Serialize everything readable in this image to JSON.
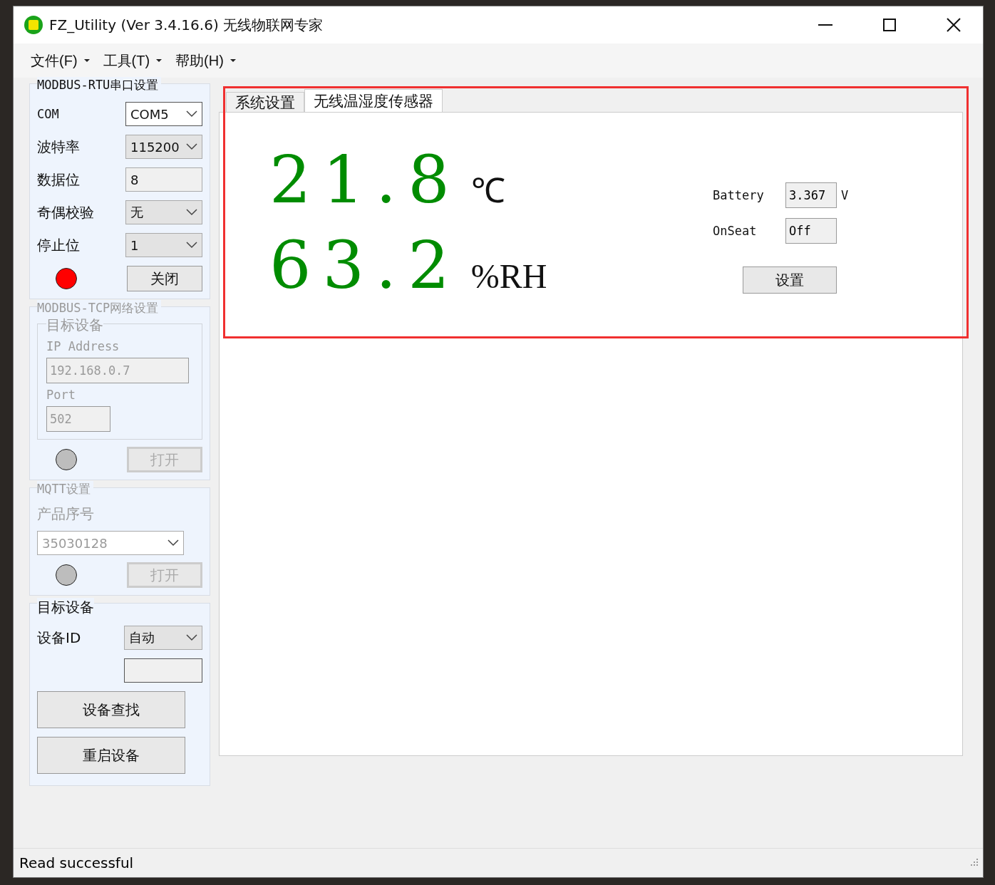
{
  "window": {
    "title": "FZ_Utility (Ver 3.4.16.6) 无线物联网专家"
  },
  "menu": [
    {
      "label": "文件(F)"
    },
    {
      "label": "工具(T)"
    },
    {
      "label": "帮助(H)"
    }
  ],
  "rtu": {
    "title": "MODBUS-RTU串口设置",
    "indicator_on": true,
    "button": "关闭",
    "fields": [
      {
        "label": "COM",
        "kind": "select",
        "value": "COM5"
      },
      {
        "label": "波特率",
        "kind": "select",
        "value": "115200"
      },
      {
        "label": "数据位",
        "kind": "input",
        "value": "8"
      },
      {
        "label": "奇偶校验",
        "kind": "select",
        "value": "无"
      },
      {
        "label": "停止位",
        "kind": "select",
        "value": "1"
      }
    ]
  },
  "tcp": {
    "title": "MODBUS-TCP网络设置",
    "disabled": true,
    "target_title": "目标设备",
    "ip_label": "IP Address",
    "ip": "192.168.0.7",
    "port_label": "Port",
    "port": "502",
    "indicator_on": false,
    "button": "打开"
  },
  "mqtt": {
    "title": "MQTT设置",
    "disabled": true,
    "serial_label": "产品序号",
    "serial": "35030128",
    "indicator_on": false,
    "button": "打开"
  },
  "target": {
    "title": "目标设备",
    "id_label": "设备ID",
    "id_mode": "自动",
    "buttons": [
      "设备查找",
      "重启设备"
    ]
  },
  "tabs": [
    {
      "label": "系统设置",
      "selected": false
    },
    {
      "label": "无线温湿度传感器",
      "selected": true
    }
  ],
  "sensor": {
    "temperature": "21.8",
    "temp_unit": "℃",
    "humidity": "63.2",
    "hum_unit": "%RH",
    "battery_label": "Battery",
    "battery": "3.367",
    "battery_unit": "V",
    "onseat_label": "OnSeat",
    "onseat": "Off",
    "button": "设置"
  },
  "status_bar": "Read successful"
}
